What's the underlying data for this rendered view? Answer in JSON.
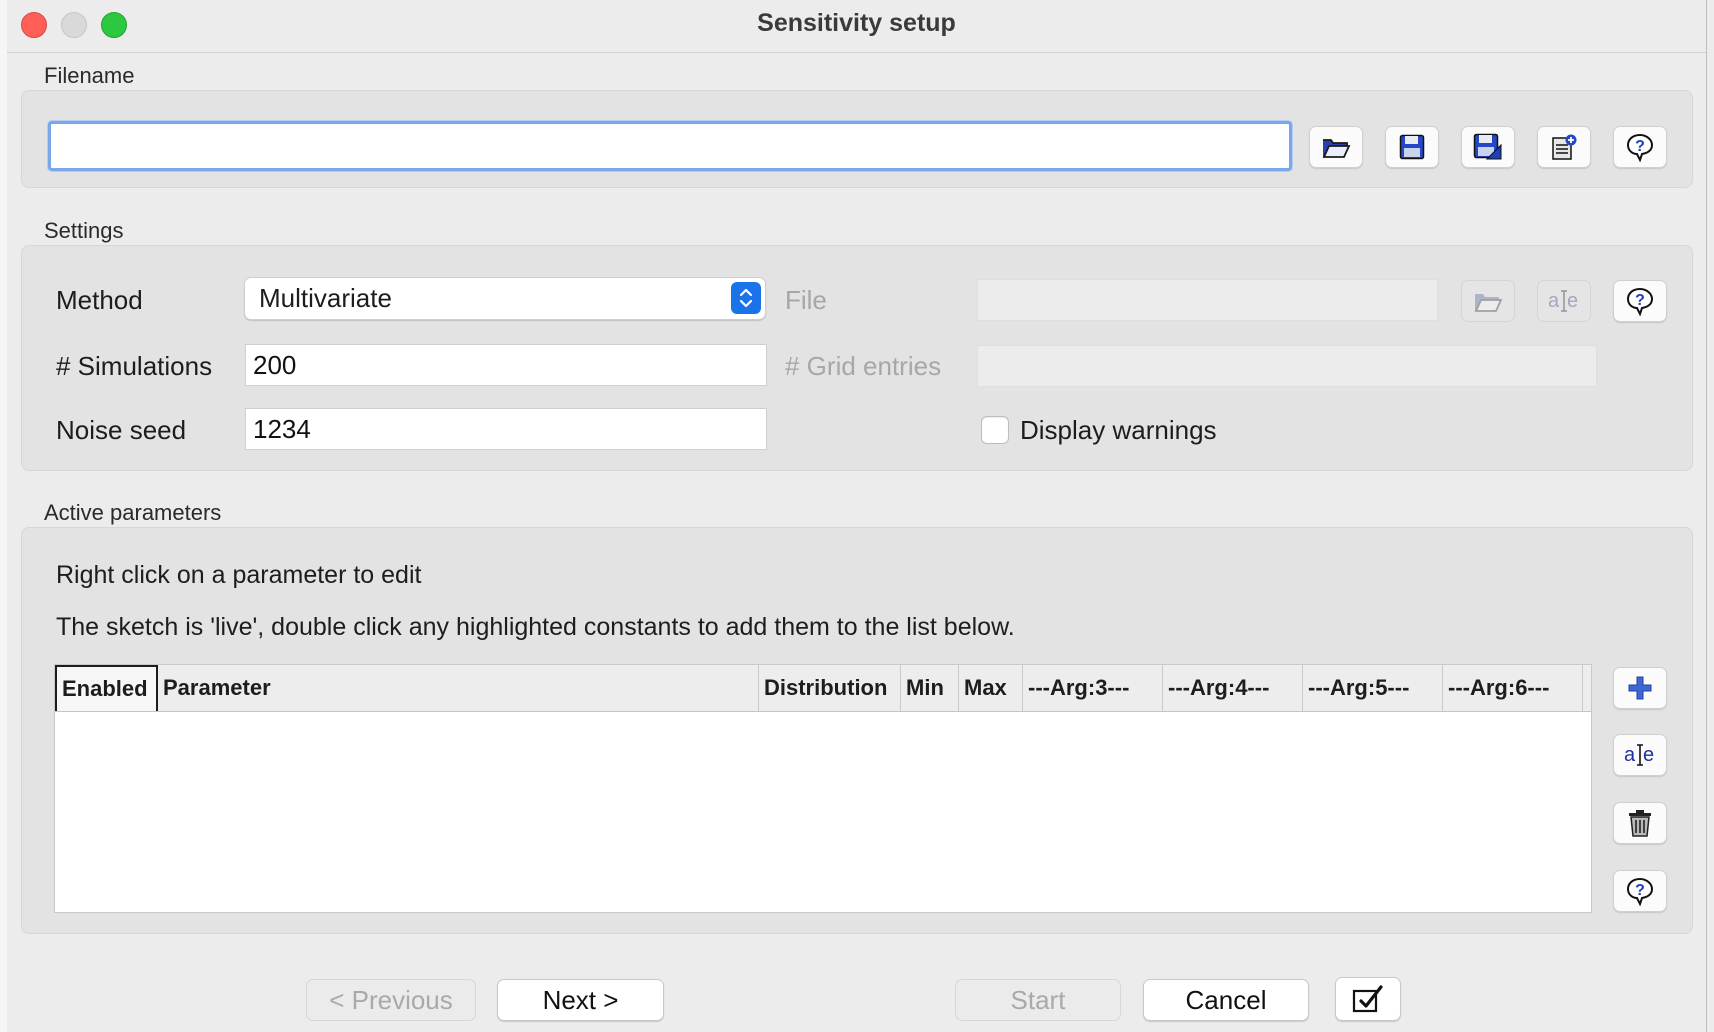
{
  "window": {
    "title": "Sensitivity setup"
  },
  "filename_group": {
    "label": "Filename",
    "value": "",
    "buttons": [
      {
        "name": "open-folder-icon"
      },
      {
        "name": "save-icon"
      },
      {
        "name": "save-as-icon"
      },
      {
        "name": "new-document-icon"
      },
      {
        "name": "help-icon"
      }
    ]
  },
  "settings": {
    "label": "Settings",
    "method_label": "Method",
    "method_value": "Multivariate",
    "file_label": "File",
    "file_value": "",
    "simulations_label": "# Simulations",
    "simulations_value": "200",
    "grid_entries_label": "# Grid entries",
    "grid_entries_value": "",
    "noise_seed_label": "Noise seed",
    "noise_seed_value": "1234",
    "display_warnings_label": "Display warnings",
    "display_warnings_checked": false
  },
  "active_parameters": {
    "label": "Active parameters",
    "note1": "Right click on a parameter to edit",
    "note2": "The sketch is 'live', double click any highlighted constants to add them to the list below.",
    "columns": [
      "Enabled",
      "Parameter",
      "Distribution",
      "Min",
      "Max",
      "---Arg:3---",
      "---Arg:4---",
      "---Arg:5---",
      "---Arg:6---"
    ],
    "rows": []
  },
  "footer": {
    "previous_label": "< Previous",
    "next_label": "Next >",
    "start_label": "Start",
    "cancel_label": "Cancel"
  },
  "colors": {
    "accent": "#1a73e8",
    "icon_blue": "#1f3fb8",
    "focus_ring": "#7aa6ea"
  }
}
